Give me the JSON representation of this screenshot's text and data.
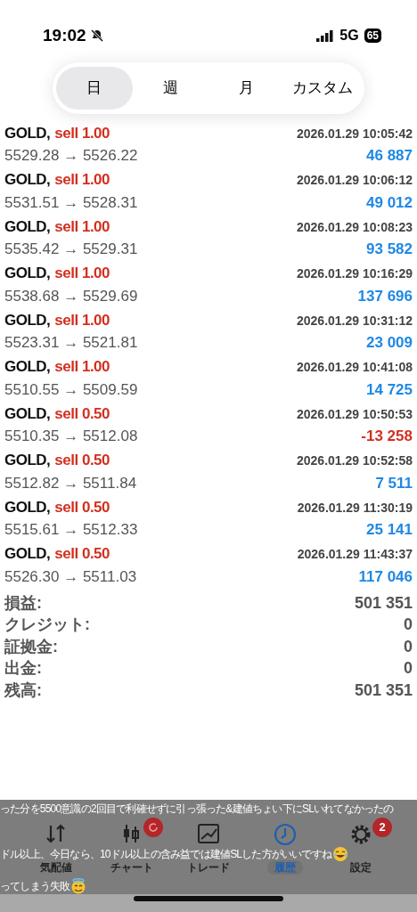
{
  "status_bar": {
    "time": "19:02",
    "network": "5G",
    "battery": "65"
  },
  "period_tabs": [
    {
      "label": "日",
      "selected": true
    },
    {
      "label": "週",
      "selected": false
    },
    {
      "label": "月",
      "selected": false
    },
    {
      "label": "カスタム",
      "selected": false
    }
  ],
  "deals": [
    {
      "symbol": "GOLD,",
      "side": "sell 1.00",
      "time": "2026.01.29 10:05:42",
      "prices": "5529.28 → 5526.22",
      "profit": "46 887",
      "loss": false
    },
    {
      "symbol": "GOLD,",
      "side": "sell 1.00",
      "time": "2026.01.29 10:06:12",
      "prices": "5531.51 → 5528.31",
      "profit": "49 012",
      "loss": false
    },
    {
      "symbol": "GOLD,",
      "side": "sell 1.00",
      "time": "2026.01.29 10:08:23",
      "prices": "5535.42 → 5529.31",
      "profit": "93 582",
      "loss": false
    },
    {
      "symbol": "GOLD,",
      "side": "sell 1.00",
      "time": "2026.01.29 10:16:29",
      "prices": "5538.68 → 5529.69",
      "profit": "137 696",
      "loss": false
    },
    {
      "symbol": "GOLD,",
      "side": "sell 1.00",
      "time": "2026.01.29 10:31:12",
      "prices": "5523.31 → 5521.81",
      "profit": "23 009",
      "loss": false
    },
    {
      "symbol": "GOLD,",
      "side": "sell 1.00",
      "time": "2026.01.29 10:41:08",
      "prices": "5510.55 → 5509.59",
      "profit": "14 725",
      "loss": false
    },
    {
      "symbol": "GOLD,",
      "side": "sell 0.50",
      "time": "2026.01.29 10:50:53",
      "prices": "5510.35 → 5512.08",
      "profit": "-13 258",
      "loss": true
    },
    {
      "symbol": "GOLD,",
      "side": "sell 0.50",
      "time": "2026.01.29 10:52:58",
      "prices": "5512.82 → 5511.84",
      "profit": "7 511",
      "loss": false
    },
    {
      "symbol": "GOLD,",
      "side": "sell 0.50",
      "time": "2026.01.29 11:30:19",
      "prices": "5515.61 → 5512.33",
      "profit": "25 141",
      "loss": false
    },
    {
      "symbol": "GOLD,",
      "side": "sell 0.50",
      "time": "2026.01.29 11:43:37",
      "prices": "5526.30 → 5511.03",
      "profit": "117 046",
      "loss": false
    }
  ],
  "summary": [
    {
      "label": "損益:",
      "value": "501 351"
    },
    {
      "label": "クレジット:",
      "value": "0"
    },
    {
      "label": "証拠金:",
      "value": "0"
    },
    {
      "label": "出金:",
      "value": "0"
    },
    {
      "label": "残高:",
      "value": "501 351"
    }
  ],
  "bottom_tabs": [
    {
      "kind": "quotes",
      "label": "気配値",
      "selected": false
    },
    {
      "kind": "chart",
      "label": "チャート",
      "selected": false,
      "refresh_badge": true
    },
    {
      "kind": "trade",
      "label": "トレード",
      "selected": false
    },
    {
      "kind": "history",
      "label": "履歴",
      "selected": true
    },
    {
      "kind": "settings",
      "label": "設定",
      "selected": false,
      "badge_count": "2"
    }
  ],
  "caption_lines": [
    {
      "kind": "plain",
      "text": "った分を5500意識の2回目で利確せずに引っ張った&建値ちょい下にSLいれてなかったの"
    },
    {
      "kind": "laugh",
      "text": "ドル以上、今日なら、10ドル以上の含み益では建値SLした方がいいですね"
    },
    {
      "kind": "halo",
      "text": "ってしまう失敗"
    }
  ]
}
